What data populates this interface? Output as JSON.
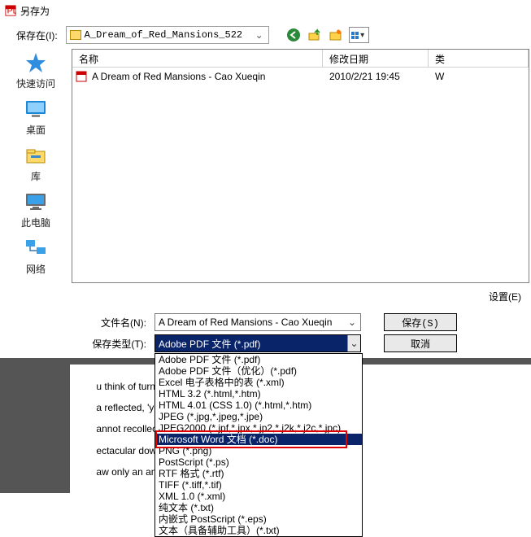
{
  "window": {
    "title": "另存为"
  },
  "toprow": {
    "label": "保存在(I):",
    "folder": "A_Dream_of_Red_Mansions_522"
  },
  "places": [
    {
      "key": "quick",
      "label": "快速访问"
    },
    {
      "key": "desktop",
      "label": "桌面"
    },
    {
      "key": "library",
      "label": "库"
    },
    {
      "key": "thispc",
      "label": "此电脑"
    },
    {
      "key": "network",
      "label": "网络"
    }
  ],
  "columns": {
    "name": "名称",
    "date": "修改日期",
    "type": "类"
  },
  "files": [
    {
      "name": "A Dream of Red Mansions - Cao Xueqin",
      "date": "2010/2/21 19:45",
      "type": "W"
    }
  ],
  "settings_btn": "设置(E)",
  "filename_label": "文件名(N):",
  "filename_value": "A Dream of Red Mansions - Cao Xueqin",
  "type_label": "保存类型(T):",
  "type_selected": "Adobe PDF 文件 (*.pdf)",
  "save_btn": "保存(S)",
  "cancel_btn": "取消",
  "type_options": [
    "Adobe PDF 文件 (*.pdf)",
    "Adobe PDF 文件（优化）(*.pdf)",
    "Excel 电子表格中的表 (*.xml)",
    "HTML 3.2 (*.html,*.htm)",
    "HTML 4.01 (CSS 1.0) (*.html,*.htm)",
    "JPEG (*.jpg,*.jpeg,*.jpe)",
    "JPEG2000 (*.jpf,*.jpx,*.jp2,*.j2k,*.j2c,*.jpc)",
    "Microsoft Word 文档 (*.doc)",
    "PNG (*.png)",
    "PostScript (*.ps)",
    "RTF 格式 (*.rtf)",
    "TIFF (*.tiff,*.tif)",
    "XML 1.0 (*.xml)",
    "纯文本 (*.txt)",
    "内嵌式 PostScript (*.eps)",
    "文本（具备辅助工具）(*.txt)"
  ],
  "highlighted_option_index": 7,
  "bg_lines": [
    "u think of turning back.",
    "a reflected, 'yet the sentiment is",
    "annot recollect having ever seen",
    "ectacular downfall and dramatic c",
    "aw only an ancient, wizened monk"
  ]
}
